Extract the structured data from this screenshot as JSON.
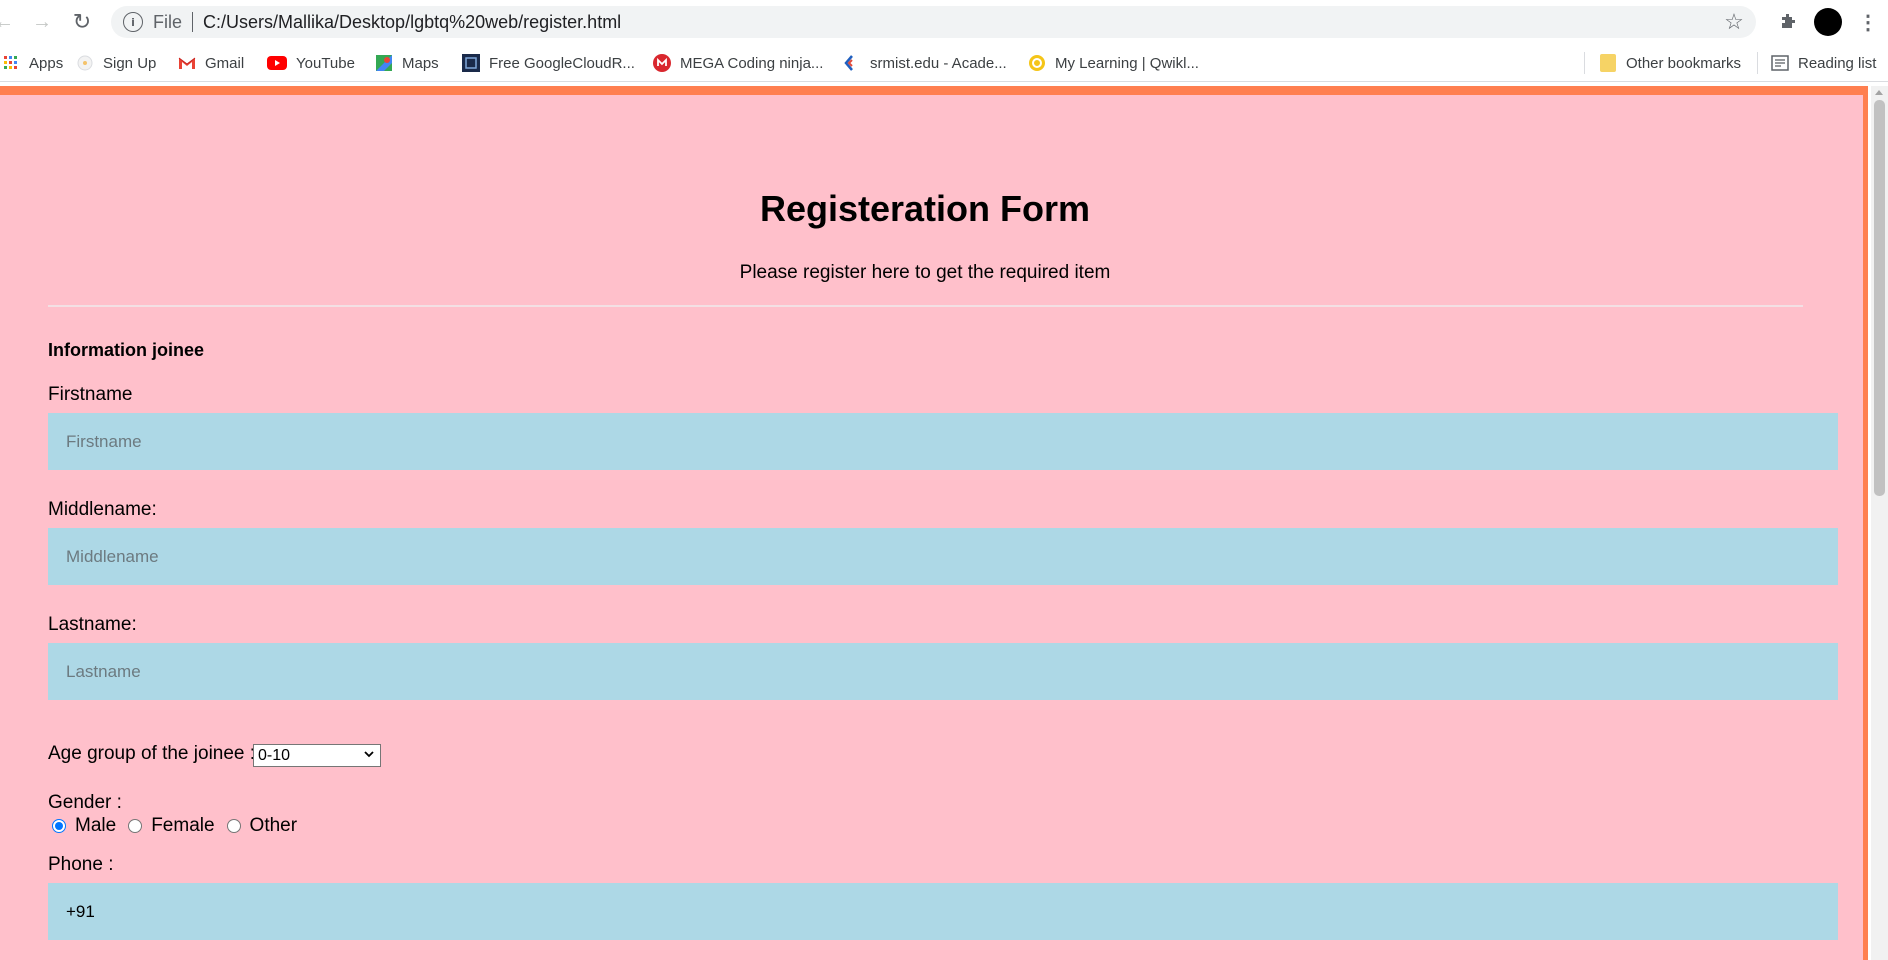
{
  "browser": {
    "file_label": "File",
    "url": "C:/Users/Mallika/Desktop/lgbtq%20web/register.html",
    "nav_back_icon": "←",
    "nav_forward_icon": "→",
    "reload_icon": "↻",
    "star_icon": "☆",
    "menu_icon": "⋮"
  },
  "bookmarks": {
    "items": [
      {
        "label": "Apps"
      },
      {
        "label": "Sign Up"
      },
      {
        "label": "Gmail"
      },
      {
        "label": "YouTube"
      },
      {
        "label": "Maps"
      },
      {
        "label": "Free GoogleCloudR..."
      },
      {
        "label": "MEGA Coding ninja..."
      },
      {
        "label": "srmist.edu - Acade..."
      },
      {
        "label": "My Learning | Qwikl..."
      }
    ],
    "other": "Other bookmarks",
    "reading_list": "Reading list"
  },
  "form": {
    "title": "Registeration Form",
    "subtitle": "Please register here to get the required item",
    "section": "Information joinee",
    "firstname_label": "Firstname",
    "firstname_placeholder": "Firstname",
    "middlename_label": "Middlename:",
    "middlename_placeholder": "Middlename",
    "lastname_label": "Lastname:",
    "lastname_placeholder": "Lastname",
    "age_label": "Age group of the joinee :",
    "age_value": "0-10",
    "gender_label": "Gender :",
    "gender_options": [
      "Male",
      "Female",
      "Other"
    ],
    "gender_selected": "Male",
    "phone_label": "Phone :",
    "phone_value": "+91"
  },
  "colors": {
    "page_bg": "#ffc0cb",
    "border": "#ff7f50",
    "field_bg": "#add8e6"
  }
}
